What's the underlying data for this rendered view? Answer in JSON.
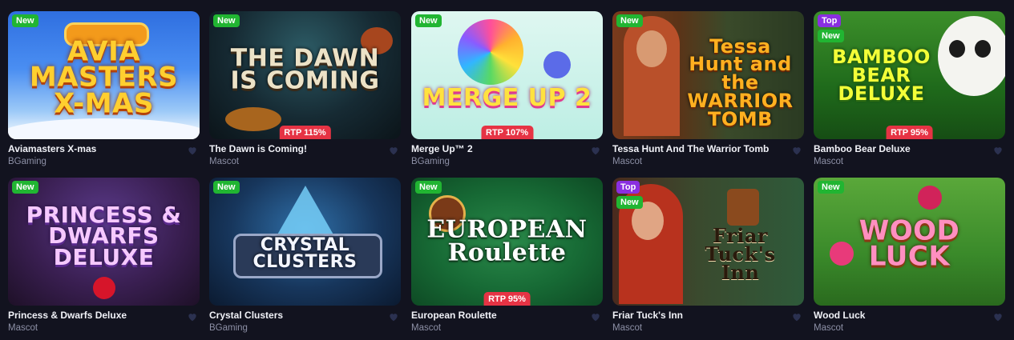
{
  "games": [
    {
      "title": "Aviamasters X-mas",
      "provider": "BGaming",
      "art_text": "AVIA MASTERS X-MAS",
      "badges": [
        "New"
      ],
      "rtp": ""
    },
    {
      "title": "The Dawn is Coming!",
      "provider": "Mascot",
      "art_text": "THE DAWN IS COMING",
      "badges": [
        "New"
      ],
      "rtp": "RTP 115%"
    },
    {
      "title": "Merge Up™ 2",
      "provider": "BGaming",
      "art_text": "MERGE UP 2",
      "badges": [
        "New"
      ],
      "rtp": "RTP 107%"
    },
    {
      "title": "Tessa Hunt And The Warrior Tomb",
      "provider": "Mascot",
      "art_text": "Tessa Hunt and the WARRIOR TOMB",
      "badges": [
        "New"
      ],
      "rtp": ""
    },
    {
      "title": "Bamboo Bear Deluxe",
      "provider": "Mascot",
      "art_text": "BAMBOO BEAR DELUXE",
      "badges": [
        "Top",
        "New"
      ],
      "rtp": "RTP 95%"
    },
    {
      "title": "Princess & Dwarfs Deluxe",
      "provider": "Mascot",
      "art_text": "PRINCESS & DWARFS DELUXE",
      "badges": [
        "New"
      ],
      "rtp": ""
    },
    {
      "title": "Crystal Clusters",
      "provider": "BGaming",
      "art_text": "CRYSTAL CLUSTERS",
      "badges": [
        "New"
      ],
      "rtp": ""
    },
    {
      "title": "European Roulette",
      "provider": "Mascot",
      "art_text": "EUROPEAN Roulette",
      "badges": [
        "New"
      ],
      "rtp": "RTP 95%"
    },
    {
      "title": "Friar Tuck's Inn",
      "provider": "Mascot",
      "art_text": "Friar Tuck's Inn",
      "badges": [
        "Top",
        "New"
      ],
      "rtp": ""
    },
    {
      "title": "Wood Luck",
      "provider": "Mascot",
      "art_text": "WOOD LUCK",
      "badges": [
        "New"
      ],
      "rtp": ""
    }
  ],
  "colors": {
    "background": "#12131f",
    "badge_new": "#21b532",
    "badge_top": "#8a2fe0",
    "rtp_badge": "#e63344",
    "provider_text": "#8d90a6",
    "heart_icon": "#2b3150"
  },
  "icons": {
    "favorite": "heart-icon"
  }
}
